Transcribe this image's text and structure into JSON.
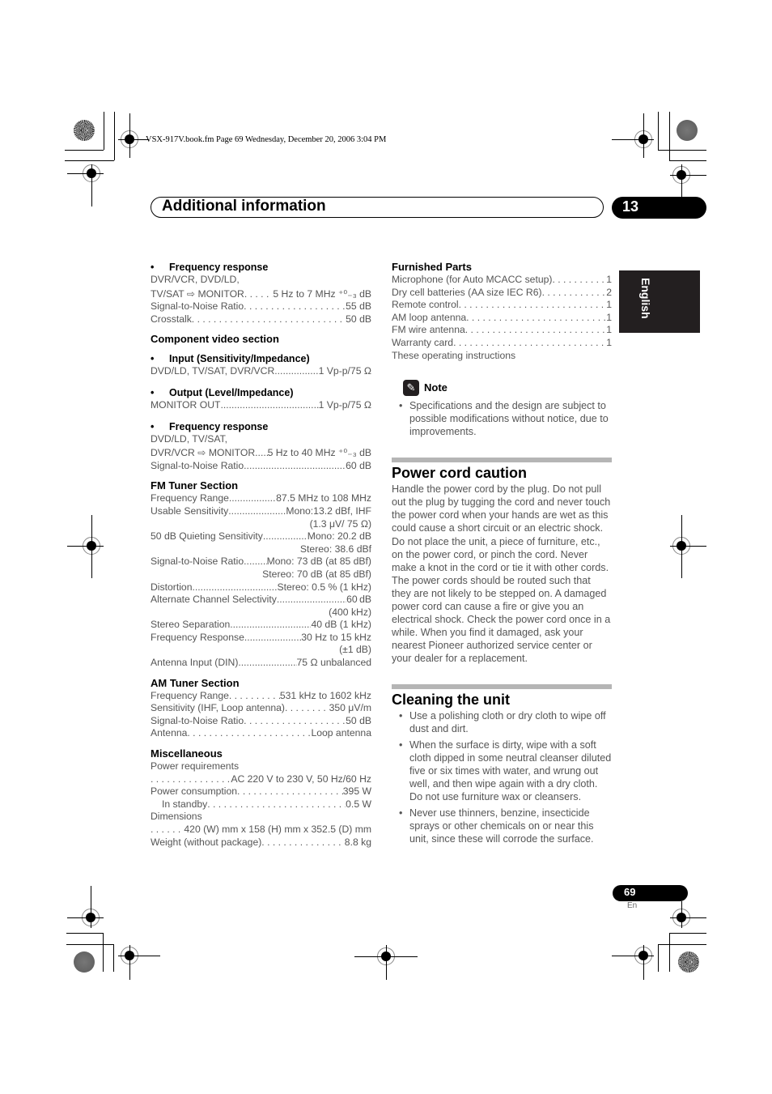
{
  "file_info": "VSX-917V.book.fm  Page 69  Wednesday, December 20, 2006  3:04 PM",
  "header": {
    "title": "Additional information",
    "chapter": "13"
  },
  "language_tab": "English",
  "left_column": {
    "video_freq": {
      "bullet_title": "Frequency response",
      "line1": "DVR/VCR, DVD/LD,",
      "rows": [
        {
          "k": "TV/SAT ⇨ MONITOR",
          "v": "5 Hz to 7 MHz ⁺⁰₋₃ dB"
        },
        {
          "k": "Signal-to-Noise Ratio",
          "v": "55 dB"
        },
        {
          "k": "Crosstalk",
          "v": "50 dB"
        }
      ]
    },
    "component": {
      "title": "Component video section",
      "input_title": "Input (Sensitivity/Impedance)",
      "input_row": {
        "k": "DVD/LD, TV/SAT, DVR/VCR",
        "v": "1 Vp-p/75 Ω"
      },
      "output_title": "Output (Level/Impedance)",
      "output_row": {
        "k": "MONITOR OUT",
        "v": "1 Vp-p/75 Ω"
      },
      "freq_title": "Frequency response",
      "freq_line1": "DVD/LD, TV/SAT,",
      "freq_rows": [
        {
          "k": "DVR/VCR ⇨ MONITOR ",
          "v": "5 Hz to 40 MHz ⁺⁰₋₃ dB"
        },
        {
          "k": "Signal-to-Noise Ratio",
          "v": "60 dB"
        }
      ]
    },
    "fm": {
      "title": "FM Tuner Section",
      "rows": [
        {
          "k": "Frequency Range",
          "v": "87.5 MHz to 108 MHz"
        },
        {
          "k": "Usable Sensitivity ",
          "v": "Mono:13.2 dBf, IHF"
        },
        {
          "cont": "(1.3 μV/ 75 Ω)"
        },
        {
          "k": "50 dB Quieting Sensitivity",
          "v": "Mono: 20.2 dB"
        },
        {
          "cont": "Stereo: 38.6 dBf"
        },
        {
          "k": "Signal-to-Noise Ratio",
          "v": "Mono: 73 dB (at 85 dBf)"
        },
        {
          "cont": "Stereo: 70 dB (at 85 dBf)"
        },
        {
          "k": "Distortion",
          "v": "Stereo: 0.5 % (1 kHz)"
        },
        {
          "k": "Alternate Channel Selectivity ",
          "v": "60 dB"
        },
        {
          "cont": "(400 kHz)"
        },
        {
          "k": "Stereo Separation ",
          "v": "40 dB (1 kHz)"
        },
        {
          "k": "Frequency Response ",
          "v": "30 Hz to 15 kHz"
        },
        {
          "cont": "(±1 dB)"
        },
        {
          "k": "Antenna Input (DIN) ",
          "v": "75 Ω unbalanced"
        }
      ]
    },
    "am": {
      "title": "AM Tuner Section",
      "rows": [
        {
          "k": "Frequency Range",
          "v": " 531 kHz to 1602 kHz"
        },
        {
          "k": "Sensitivity (IHF, Loop antenna)",
          "v": "350 μV/m"
        },
        {
          "k": "Signal-to-Noise Ratio",
          "v": "50 dB"
        },
        {
          "k": "Antenna ",
          "v": " Loop antenna"
        }
      ]
    },
    "misc": {
      "title": "Miscellaneous",
      "power_req_label": "Power requirements",
      "power_req_value": "AC 220 V to 230 V, 50 Hz/60 Hz",
      "power_cons": {
        "k": "Power consumption ",
        "v": " 395 W"
      },
      "standby": {
        "k": "In standby",
        "v": "0.5 W"
      },
      "dimensions_label": "Dimensions",
      "dimensions_value": " 420 (W) mm x 158 (H) mm x 352.5 (D) mm",
      "weight": {
        "k": "Weight (without package)",
        "v": "8.8 kg"
      }
    }
  },
  "right_column": {
    "furnished": {
      "title": "Furnished Parts",
      "rows": [
        {
          "k": "Microphone (for Auto MCACC setup)",
          "v": " 1"
        },
        {
          "k": "Dry cell batteries (AA size IEC R6)",
          "v": " 2"
        },
        {
          "k": "Remote control ",
          "v": " 1"
        },
        {
          "k": "AM loop antenna ",
          "v": " 1"
        },
        {
          "k": "FM wire antenna",
          "v": " 1"
        },
        {
          "k": "Warranty card",
          "v": " 1"
        }
      ],
      "last": "These operating instructions"
    },
    "note": {
      "label": "Note",
      "items": [
        "Specifications and the design are subject to possible modifications without notice, due to improvements."
      ]
    },
    "power_cord": {
      "title": "Power cord caution",
      "body": "Handle the power cord by the plug. Do not pull out the plug by tugging the cord and never touch the power cord when your hands are wet as this could cause a short circuit or an electric shock. Do not place the unit, a piece of furniture, etc., on the power cord, or pinch the cord. Never make a knot in the cord or tie it with other cords. The power cords should be routed such that they are not likely to be stepped on. A damaged power cord can cause a fire or give you an electrical shock. Check the power cord once in a while. When you find it damaged, ask your nearest Pioneer authorized service center or your dealer for a replacement."
    },
    "cleaning": {
      "title": "Cleaning the unit",
      "items": [
        "Use a polishing cloth or dry cloth to wipe off dust and dirt.",
        "When the surface is dirty, wipe with a soft cloth dipped in some neutral cleanser diluted five or six times with water, and wrung out well, and then wipe again with a dry cloth. Do not use furniture wax or cleansers.",
        "Never use thinners, benzine, insecticide sprays or other chemicals on or near this unit, since these will corrode the surface."
      ]
    }
  },
  "footer": {
    "page": "69",
    "lang": "En"
  },
  "icons": {
    "bullet": "•",
    "note": "✎"
  }
}
